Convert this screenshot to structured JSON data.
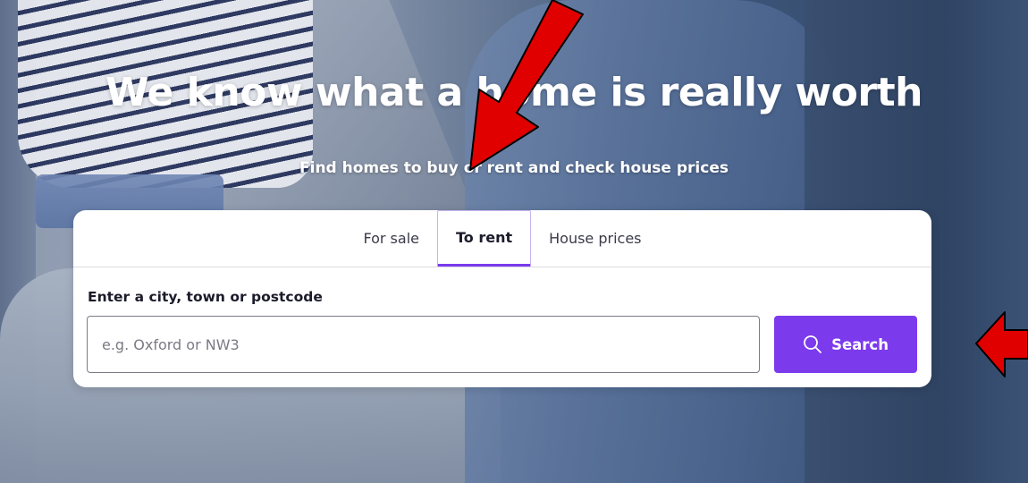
{
  "hero": {
    "headline": "We know what a home is really worth",
    "subheadline": "Find homes to buy or rent and check house prices"
  },
  "search": {
    "tabs": [
      {
        "label": "For sale",
        "active": false
      },
      {
        "label": "To rent",
        "active": true
      },
      {
        "label": "House prices",
        "active": false
      }
    ],
    "field_label": "Enter a city, town or postcode",
    "placeholder": "e.g. Oxford or NW3",
    "button_label": "Search",
    "accent_color": "#7c3aed"
  },
  "annotations": {
    "arrow_color": "#e00000"
  }
}
